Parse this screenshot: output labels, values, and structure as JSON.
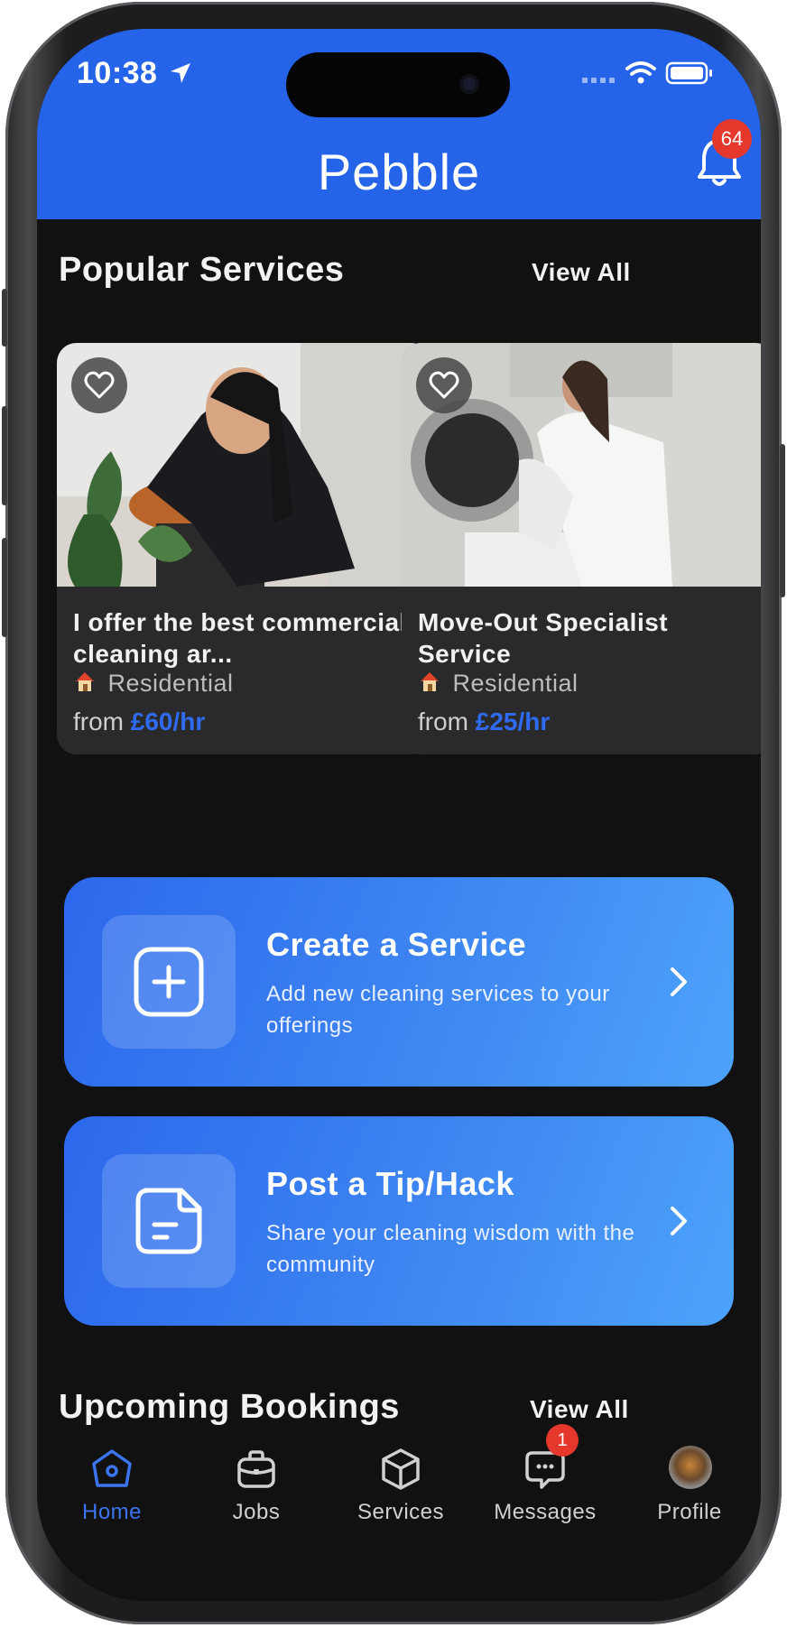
{
  "status_bar": {
    "time": "10:38"
  },
  "header": {
    "brand": "Pebble",
    "notification_count": "64"
  },
  "popular": {
    "title": "Popular Services",
    "view_all": "View All",
    "cards": [
      {
        "title": "I offer the best commercial cleaning ar...",
        "category": "Residential",
        "price_prefix": "from",
        "price": "£60/hr"
      },
      {
        "title": "Move-Out Specialist Service",
        "category": "Residential",
        "price_prefix": "from",
        "price": "£25/hr"
      }
    ]
  },
  "actions": [
    {
      "title": "Create a Service",
      "description": "Add new cleaning services to your offerings"
    },
    {
      "title": "Post a Tip/Hack",
      "description": "Share your cleaning wisdom with the community"
    }
  ],
  "bookings": {
    "title": "Upcoming Bookings",
    "view_all": "View All"
  },
  "tabs": [
    {
      "label": "Home",
      "active": true
    },
    {
      "label": "Jobs"
    },
    {
      "label": "Services"
    },
    {
      "label": "Messages",
      "badge": "1"
    },
    {
      "label": "Profile"
    }
  ],
  "colors": {
    "header": "#2563e8",
    "background": "#111112",
    "accent": "#2f6bf0",
    "badge": "#e5372c"
  }
}
